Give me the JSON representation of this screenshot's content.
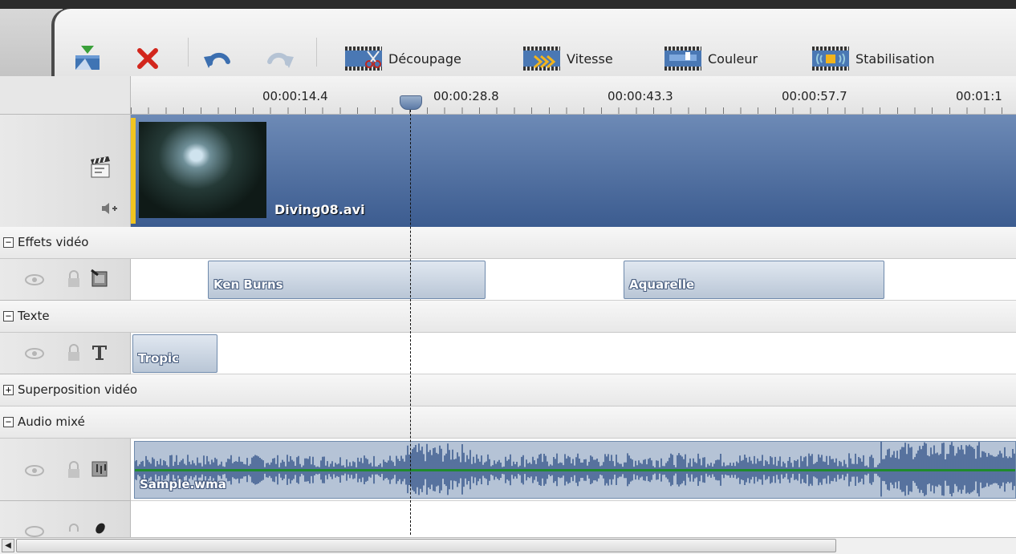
{
  "toolbar": {
    "buttons": [
      {
        "label": "Découpage",
        "icon": "scissors-film-icon"
      },
      {
        "label": "Vitesse",
        "icon": "speed-film-icon"
      },
      {
        "label": "Couleur",
        "icon": "color-film-icon"
      },
      {
        "label": "Stabilisation",
        "icon": "stabilization-film-icon"
      }
    ]
  },
  "ruler": {
    "ticks": [
      "00:00:14.4",
      "00:00:28.8",
      "00:00:43.3",
      "00:00:57.7",
      "00:01:1"
    ]
  },
  "video_track": {
    "clip_name": "Diving08.avi"
  },
  "groups": {
    "effects": {
      "toggle": "−",
      "label": "Effets vidéo"
    },
    "text": {
      "toggle": "−",
      "label": "Texte"
    },
    "overlay": {
      "toggle": "+",
      "label": "Superposition vidéo"
    },
    "audio": {
      "toggle": "−",
      "label": "Audio mixé"
    }
  },
  "effects_track": {
    "clips": [
      {
        "label": "Ken Burns"
      },
      {
        "label": "Aquarelle"
      }
    ]
  },
  "text_track": {
    "clips": [
      {
        "label": "Tropic"
      }
    ]
  },
  "audio_track": {
    "clip_name": "Sample.wma"
  },
  "colors": {
    "accent": "#5c7aa6",
    "video_track": "#4a6a9b",
    "waveform": "#2f4f86",
    "audio_center_line": "#1f8a2c",
    "clip_marker": "#f0c420"
  }
}
